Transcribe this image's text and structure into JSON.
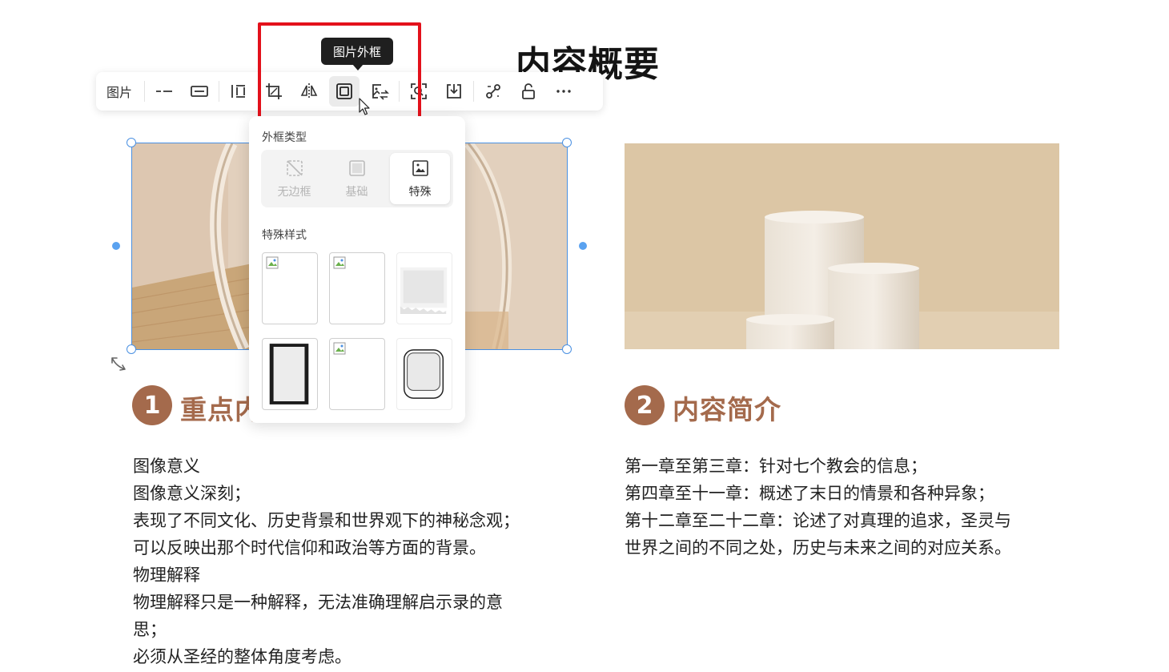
{
  "page": {
    "title": "内容概要"
  },
  "toolbar": {
    "label": "图片",
    "buttons": [
      {
        "name": "line-style-icon"
      },
      {
        "name": "border-style-icon"
      },
      {
        "name": "align-icon"
      },
      {
        "name": "crop-icon"
      },
      {
        "name": "flip-icon"
      },
      {
        "name": "image-frame-icon",
        "active": true
      },
      {
        "name": "replace-image-icon"
      },
      {
        "name": "image-search-icon"
      },
      {
        "name": "download-icon"
      },
      {
        "name": "link-icon"
      },
      {
        "name": "unlock-icon"
      },
      {
        "name": "more-icon"
      }
    ]
  },
  "tooltip": {
    "text": "图片外框"
  },
  "frame_panel": {
    "type_label": "外框类型",
    "types": [
      {
        "label": "无边框",
        "icon": "no-border-icon",
        "selected": false
      },
      {
        "label": "基础",
        "icon": "basic-frame-icon",
        "selected": false
      },
      {
        "label": "特殊",
        "icon": "special-frame-icon",
        "selected": true
      }
    ],
    "style_label": "特殊样式",
    "styles": [
      "broken-image",
      "broken-image",
      "torn-paper",
      "film-strip",
      "broken-image",
      "rounded-frame"
    ]
  },
  "sections": [
    {
      "number": "1",
      "title": "重点内",
      "lines": [
        "图像意义",
        "图像意义深刻；",
        "表现了不同文化、历史背景和世界观下的神秘念观；",
        "可以反映出那个时代信仰和政治等方面的背景。",
        "物理解释",
        "物理解释只是一种解释，无法准确理解启示录的意",
        "思；",
        "必须从圣经的整体角度考虑。"
      ]
    },
    {
      "number": "2",
      "title": "内容简介",
      "lines": [
        "第一章至第三章：针对七个教会的信息；",
        "第四章至十一章：概述了末日的情景和各种异象；",
        "第十二章至二十二章：论述了对真理的追求，圣灵与",
        "世界之间的不同之处，历史与未来之间的对应关系。"
      ]
    }
  ],
  "colors": {
    "accent": "#a46a4c",
    "highlight": "#e3111b",
    "selection": "#4a90e2"
  }
}
